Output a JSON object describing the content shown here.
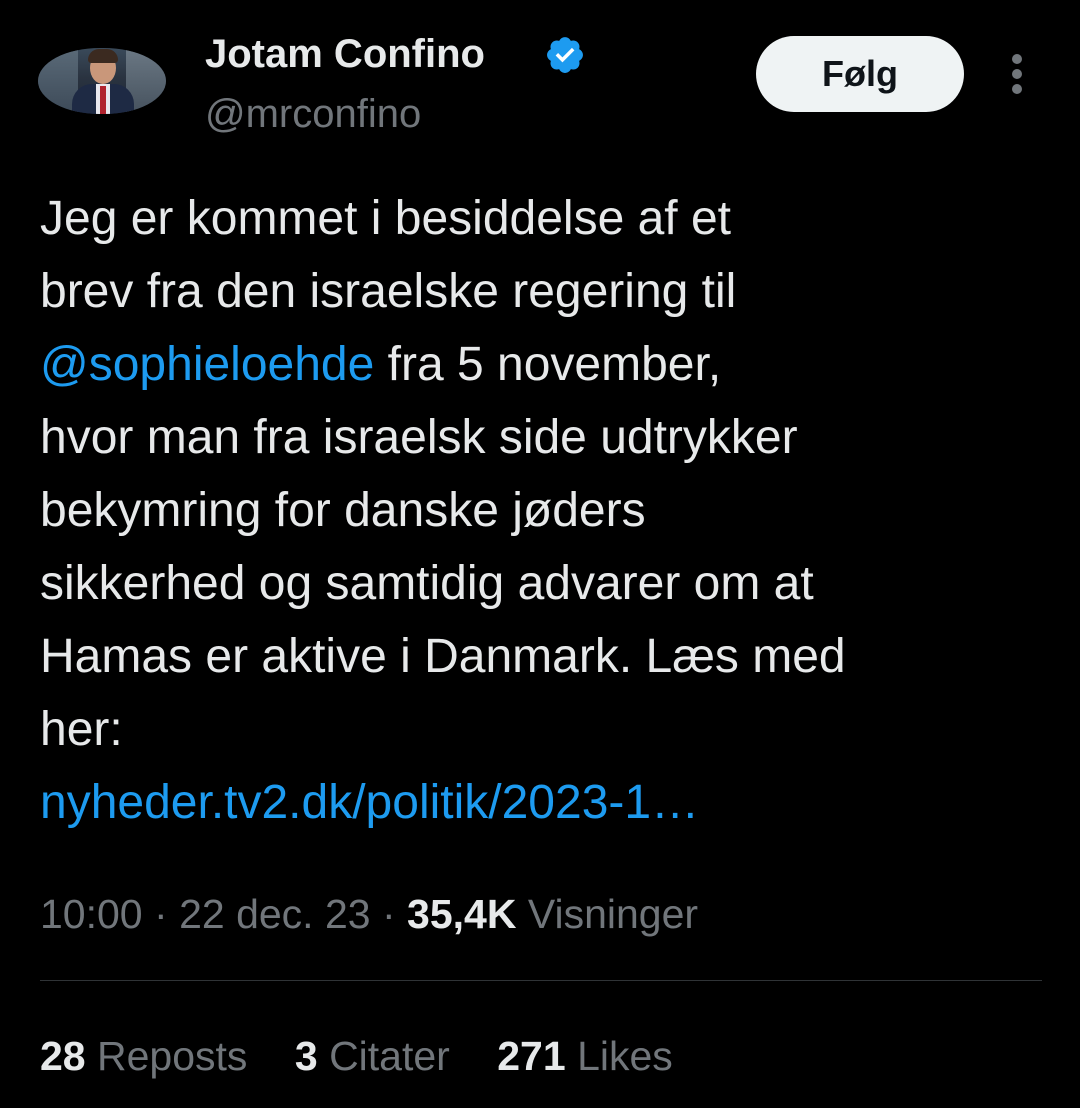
{
  "author": {
    "name": "Jotam Confino",
    "handle": "@mrconfino",
    "verified_icon": "verified-badge-icon",
    "verified_color": "#1d9bf0"
  },
  "follow_label": "Følg",
  "more_icon": "more-vertical-icon",
  "tweet": {
    "lines": [
      "Jeg er kommet i besiddelse af et",
      "brev fra den israelske regering til",
      "fra 5 november,",
      "hvor man fra israelsk side udtrykker",
      "bekymring for danske jøders",
      "sikkerhed og samtidig advarer om at",
      "Hamas er aktive i Danmark. Læs med",
      "her:"
    ],
    "mention": "@sophieloehde",
    "link": "nyheder.tv2.dk/politik/2023-1…"
  },
  "meta": {
    "time": "10:00",
    "date": "22 dec. 23",
    "separator": "·",
    "views_count": "35,4K",
    "views_label": "Visninger"
  },
  "stats": {
    "reposts_count": "28",
    "reposts_label": "Reposts",
    "quotes_count": "3",
    "quotes_label": "Citater",
    "likes_count": "271",
    "likes_label": "Likes"
  },
  "colors": {
    "background": "#000000",
    "text": "#e7e9ea",
    "muted": "#71767b",
    "link": "#1d9bf0",
    "button_bg": "#eff3f4"
  }
}
